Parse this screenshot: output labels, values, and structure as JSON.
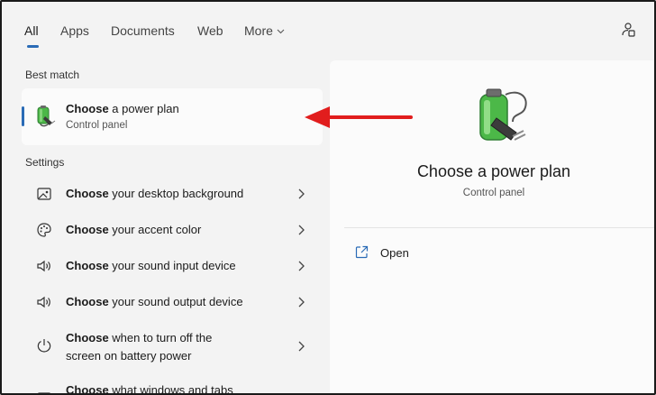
{
  "tabs": {
    "all": "All",
    "apps": "Apps",
    "documents": "Documents",
    "web": "Web",
    "more": "More",
    "active": "All"
  },
  "sections": {
    "best_match": "Best match",
    "settings": "Settings"
  },
  "best_match": {
    "title_bold": "Choose",
    "title_rest": " a power plan",
    "subtitle": "Control panel",
    "icon": "power-plan-icon"
  },
  "settings_items": [
    {
      "bold": "Choose",
      "rest": " your desktop background",
      "icon": "picture-icon"
    },
    {
      "bold": "Choose",
      "rest": " your accent color",
      "icon": "palette-icon"
    },
    {
      "bold": "Choose",
      "rest": " your sound input device",
      "icon": "speaker-icon"
    },
    {
      "bold": "Choose",
      "rest": " your sound output device",
      "icon": "speaker-icon"
    },
    {
      "bold": "Choose",
      "rest": " when to turn off the",
      "line2": "screen on battery power",
      "icon": "power-icon"
    },
    {
      "bold": "Choose",
      "rest": " what windows and tabs",
      "icon": "window-icon"
    }
  ],
  "detail": {
    "title": "Choose a power plan",
    "subtitle": "Control panel",
    "open_label": "Open"
  },
  "colors": {
    "accent": "#2a6bb6",
    "annotation_arrow": "#e11d1d",
    "battery_green": "#4cb848"
  }
}
